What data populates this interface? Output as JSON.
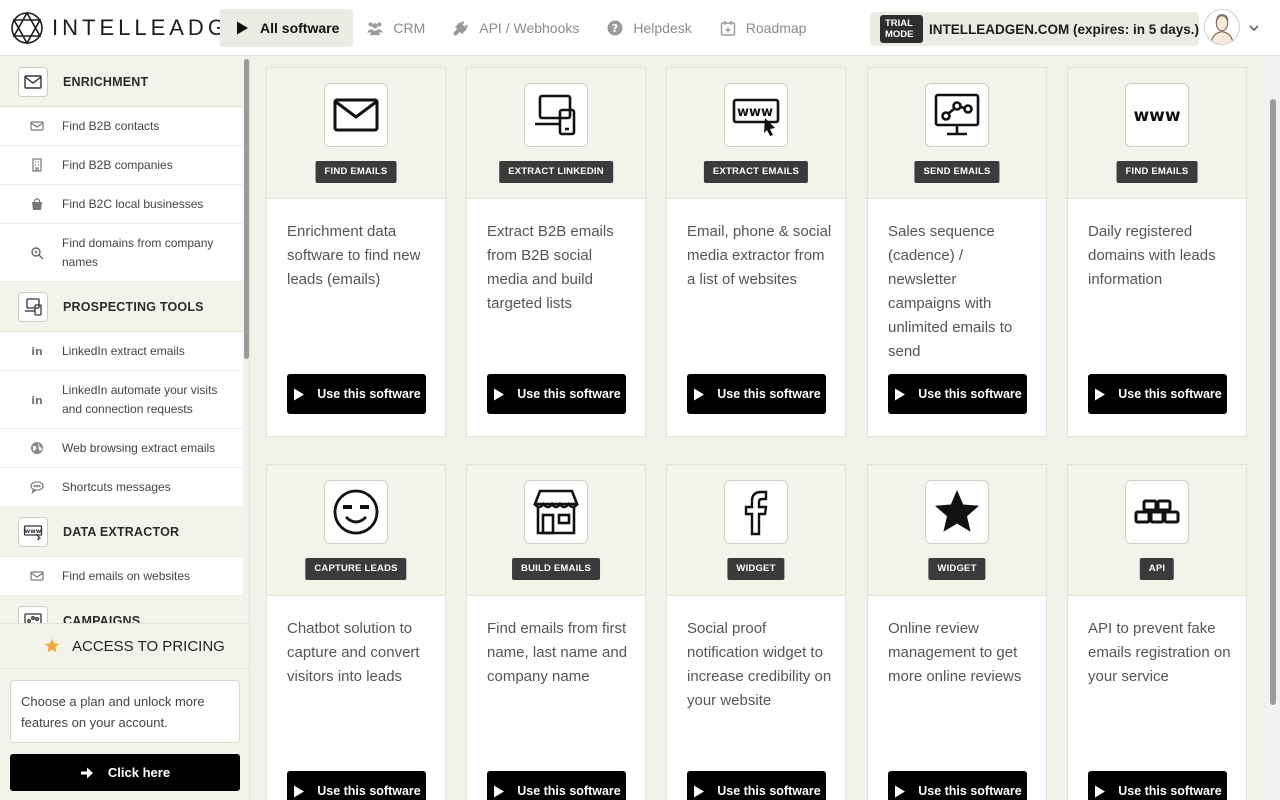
{
  "app": {
    "logo_text": "INTELLEADGEN"
  },
  "nav": [
    {
      "label": "All software",
      "icon": "play-icon",
      "active": true
    },
    {
      "label": "CRM",
      "icon": "users-icon",
      "active": false
    },
    {
      "label": "API / Webhooks",
      "icon": "plug-icon",
      "active": false
    },
    {
      "label": "Helpdesk",
      "icon": "question-icon",
      "active": false
    },
    {
      "label": "Roadmap",
      "icon": "calendar-plus-icon",
      "active": false
    }
  ],
  "trial": {
    "badge": "TRIAL MODE",
    "text": "INTELLEADGEN.COM (expires: in 5 days.)"
  },
  "sidebar": {
    "sections": [
      {
        "label": "ENRICHMENT",
        "icon": "envelope-icon",
        "items": [
          {
            "label": "Find B2B contacts",
            "icon": "envelope-icon"
          },
          {
            "label": "Find B2B companies",
            "icon": "building-icon"
          },
          {
            "label": "Find B2C local businesses",
            "icon": "shopping-bag-icon"
          },
          {
            "label": "Find domains from company names",
            "icon": "search-icon"
          }
        ]
      },
      {
        "label": "PROSPECTING TOOLS",
        "icon": "devices-icon",
        "items": [
          {
            "label": "LinkedIn extract emails",
            "icon": "linkedin-icon"
          },
          {
            "label": "LinkedIn automate your visits and connection requests",
            "icon": "linkedin-icon"
          },
          {
            "label": "Web browsing extract emails",
            "icon": "globe-icon"
          },
          {
            "label": "Shortcuts messages",
            "icon": "chat-icon"
          }
        ]
      },
      {
        "label": "DATA EXTRACTOR",
        "icon": "www-icon",
        "items": [
          {
            "label": "Find emails on websites",
            "icon": "envelope-icon"
          }
        ]
      },
      {
        "label": "CAMPAIGNS",
        "icon": "monitor-icon",
        "items": []
      }
    ]
  },
  "pricing": {
    "title": "ACCESS TO PRICING",
    "description": "Choose a plan and unlock more features on your account.",
    "button": "Click here"
  },
  "cards": [
    {
      "tag": "FIND EMAILS",
      "icon": "envelope-icon",
      "description": "Enrichment data software to find new leads (emails)",
      "button": "Use this software"
    },
    {
      "tag": "EXTRACT LINKEDIN",
      "icon": "devices-icon",
      "description": "Extract B2B emails from B2B social media and build targeted lists",
      "button": "Use this software"
    },
    {
      "tag": "EXTRACT EMAILS",
      "icon": "www-cursor-icon",
      "description": "Email, phone & social media extractor from a list of websites",
      "button": "Use this software"
    },
    {
      "tag": "SEND EMAILS",
      "icon": "monitor-chart-icon",
      "description": "Sales sequence (cadence) / newsletter campaigns with unlimited emails to send",
      "button": "Use this software"
    },
    {
      "tag": "FIND EMAILS",
      "icon": "www-icon",
      "description": "Daily registered domains with leads information",
      "button": "Use this software"
    },
    {
      "tag": "CAPTURE LEADS",
      "icon": "smiley-icon",
      "description": "Chatbot solution to capture and convert visitors into leads",
      "button": "Use this software"
    },
    {
      "tag": "BUILD EMAILS",
      "icon": "store-icon",
      "description": "Find emails from first name, last name and company name",
      "button": "Use this software"
    },
    {
      "tag": "WIDGET",
      "icon": "facebook-icon",
      "description": "Social proof notification widget to increase credibility on your website",
      "button": "Use this software"
    },
    {
      "tag": "WIDGET",
      "icon": "star-icon",
      "description": "Online review management to get more online reviews",
      "button": "Use this software"
    },
    {
      "tag": "API",
      "icon": "bricks-icon",
      "description": "API to prevent fake emails registration on your service",
      "button": "Use this software"
    }
  ]
}
